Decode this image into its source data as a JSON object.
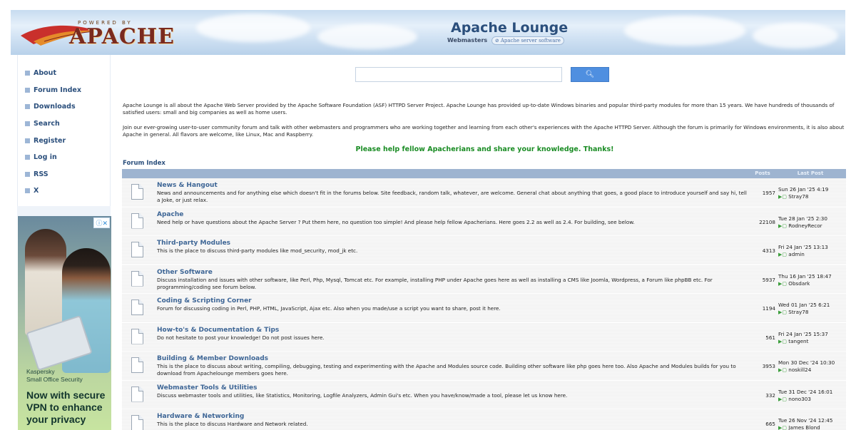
{
  "header": {
    "logo_powered": "POWERED BY",
    "logo_word": "APACHE",
    "title": "Apache Lounge",
    "subtitle": "Webmasters",
    "subtitle_link": "Apache server software"
  },
  "sidebar": {
    "items": [
      {
        "label": "About"
      },
      {
        "label": "Forum Index"
      },
      {
        "label": "Downloads"
      },
      {
        "label": "Search"
      },
      {
        "label": "Register"
      },
      {
        "label": "Log in"
      },
      {
        "label": "RSS"
      },
      {
        "label": "X"
      }
    ]
  },
  "ad": {
    "brand_line1": "Kaspersky",
    "brand_line2": "Small Office Security",
    "tagline": "Now with secure VPN to enhance your privacy",
    "close": "ⓘ✕"
  },
  "search": {
    "placeholder": "",
    "button_icon": "search-icon"
  },
  "intro": {
    "p1": "Apache Lounge is all about the Apache Web Server provided by the Apache Software Foundation (ASF) HTTPD Server Project. Apache Lounge has provided up-to-date Windows binaries and popular third-party modules for more than 15 years. We have hundreds of thousands of satisfied users: small and big companies as well as home users.",
    "p2": "Join our ever-growing user-to-user community forum and talk with other webmasters and programmers who are working together and learning from each other's experiences with the Apache HTTPD Server. Although the forum is primarily for Windows environments, it is also about Apache in general. All flavors are welcome, like Linux, Mac and Raspberry.",
    "help": "Please help fellow Apacherians and share your knowledge. Thanks!"
  },
  "forum": {
    "index_label": "Forum Index",
    "col_posts": "Posts",
    "col_last": "Last Post",
    "rows": [
      {
        "title": "News & Hangout",
        "desc": "News and announcements and for anything else which doesn't fit in the forums below. Site feedback, random talk, whatever, are welcome. General chat about anything that goes, a good place to introduce yourself and say hi, tell a Joke, or just relax.",
        "posts": "1957",
        "last_date": "Sun 26 Jan '25 4:19",
        "last_user": "Stray78"
      },
      {
        "title": "Apache",
        "desc": "Need help or have questions about the Apache Server ? Put them here, no question too simple! And please help fellow Apacherians. Here goes 2.2 as well as 2.4. For building, see below.",
        "posts": "22108",
        "last_date": "Tue 28 Jan '25 2:30",
        "last_user": "RodneyRecor"
      },
      {
        "title": "Third-party Modules",
        "desc": "This is the place to discuss third-party modules like mod_security, mod_jk etc.",
        "posts": "4313",
        "last_date": "Fri 24 Jan '25 13:13",
        "last_user": "admin"
      },
      {
        "title": "Other Software",
        "desc": "Discuss installation and issues with other software, like Perl, Php, Mysql, Tomcat etc. For example, installing PHP under Apache goes here as well as installing a CMS like Joomla, Wordpress, a Forum like phpBB etc. For programming/coding see forum below.",
        "posts": "5937",
        "last_date": "Thu 16 Jan '25 18:47",
        "last_user": "Obsdark"
      },
      {
        "title": "Coding & Scripting Corner",
        "desc": "Forum for discussing coding in Perl, PHP, HTML, JavaScript, Ajax etc. Also when you made/use a script you want to share, post it here.",
        "posts": "1194",
        "last_date": "Wed 01 Jan '25 6:21",
        "last_user": "Stray78"
      },
      {
        "title": "How-to's & Documentation & Tips",
        "desc": "Do not hesitate to post your knowledge! Do not post issues here.",
        "posts": "561",
        "last_date": "Fri 24 Jan '25 15:37",
        "last_user": "tangent"
      },
      {
        "title": "Building & Member Downloads",
        "desc": "This is the place to discuss about writing, compiling, debugging, testing and experimenting with the Apache and Modules source code. Building other software like php goes here too. Also Apache and Modules builds for you to download from Apachelounge members goes here.",
        "posts": "3953",
        "last_date": "Mon 30 Dec '24 10:30",
        "last_user": "noskill24"
      },
      {
        "title": "Webmaster Tools & Utilities",
        "desc": "Discuss webmaster tools and utilities, like Statistics, Monitoring, Logfile Analyzers, Admin Gui's etc. When you have/know/made a tool, please let us know here.",
        "posts": "332",
        "last_date": "Tue 31 Dec '24 16:01",
        "last_user": "nono303"
      },
      {
        "title": "Hardware & Networking",
        "desc": "This is the place to discuss Hardware and Network related.",
        "posts": "665",
        "last_date": "Tue 26 Nov '24 12:45",
        "last_user": "James Blond"
      }
    ]
  }
}
